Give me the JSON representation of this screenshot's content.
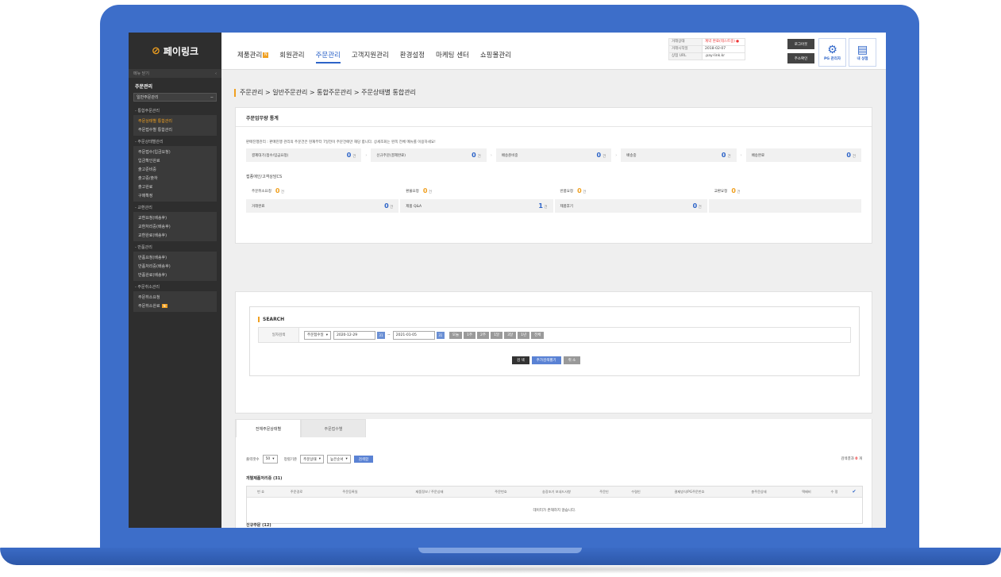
{
  "sidebar": {
    "logo": "페이링크",
    "menu_toggle": "메뉴 닫기",
    "title": "주문관리",
    "select": "일반주문관리",
    "groups": [
      {
        "label": "- 통합주문관리",
        "items": [
          {
            "label": "주문상태별 통합관리",
            "active": true
          },
          {
            "label": "주문접수별 통합관리"
          }
        ]
      },
      {
        "label": "- 주문상태별관리",
        "items": [
          {
            "label": "주문접수(입금요청)"
          },
          {
            "label": "입금확인완료"
          },
          {
            "label": "출고준비중"
          },
          {
            "label": "출고중/출하"
          },
          {
            "label": "출고완료"
          },
          {
            "label": "구매확정"
          }
        ]
      },
      {
        "label": "- 교환관리",
        "items": [
          {
            "label": "교환요청(배송후)"
          },
          {
            "label": "교환처리중(배송후)"
          },
          {
            "label": "교환완료(배송후)"
          }
        ]
      },
      {
        "label": "- 반품관리",
        "items": [
          {
            "label": "반품요청(배송후)"
          },
          {
            "label": "반품처리중(배송후)"
          },
          {
            "label": "반품완료(배송후)"
          }
        ]
      },
      {
        "label": "- 주문취소관리",
        "items": [
          {
            "label": "주문취소요청"
          },
          {
            "label": "주문취소완료",
            "badge": "N"
          }
        ]
      }
    ]
  },
  "header": {
    "tabs": [
      {
        "label": "제품관리",
        "badge": "N"
      },
      {
        "label": "회원관리"
      },
      {
        "label": "주문관리",
        "active": true
      },
      {
        "label": "고객지원관리"
      },
      {
        "label": "환경설정"
      },
      {
        "label": "마케팅 센터"
      },
      {
        "label": "쇼핑몰관리"
      }
    ],
    "info": [
      {
        "label": "거래상태",
        "value": "계약 완료(테스트중)"
      },
      {
        "label": "거래시작일",
        "value": "2018-02-07"
      },
      {
        "label": "상점 URL",
        "value": ".pay-link.kr"
      }
    ],
    "logout": "로그아웃",
    "user_info": "주소확인",
    "pg_admin": "PG 관리자",
    "my_store": "내 상점"
  },
  "breadcrumb": "주문관리 > 일반주문관리 > 통합주문관리 > 주문상태별 통합관리",
  "stats": {
    "title": "주문업무량 통계",
    "note": "판매진행관리 : 판매진행 관리의 주문건은 현재부터 7일전이 주문건에만 해당 합니다. 상세조회는 왼쪽 전체 메뉴를 이용하세요!",
    "unit": "건",
    "flow": [
      {
        "label": "결제대기(접수/입금요청)",
        "count": "0"
      },
      {
        "label": "신규주문(결제완료)",
        "count": "0"
      },
      {
        "label": "배송준비중",
        "count": "0"
      },
      {
        "label": "배송중",
        "count": "0"
      },
      {
        "label": "배송완료",
        "count": "0"
      }
    ],
    "cs_title": "접종애인/고객상담CS",
    "cs": [
      {
        "label": "주문취소요청",
        "count": "0",
        "style": "orange"
      },
      {
        "label": "환불요청",
        "count": "0",
        "style": "orange"
      },
      {
        "label": "반품요청",
        "count": "0",
        "style": "orange"
      },
      {
        "label": "교환요청",
        "count": "0",
        "style": "orange"
      },
      {
        "label": "거래완료",
        "count": "0",
        "style": "blue"
      },
      {
        "label": "제품 Q&A",
        "count": "1",
        "style": "blue"
      },
      {
        "label": "제품후기",
        "count": "0",
        "style": "blue"
      },
      {
        "label": "",
        "count": "",
        "style": "blank"
      }
    ]
  },
  "search": {
    "title": "SEARCH",
    "date_label": "일자검색",
    "date_type": "주문접수일",
    "start_date": "2020-12-29",
    "end_date": "2021-01-05",
    "periods": [
      "오늘",
      "1주",
      "2주",
      "1달",
      "3달",
      "1년",
      "전체"
    ],
    "search_btn": "검 색",
    "detail_btn": "추가검색펼기",
    "cancel_btn": "취 소"
  },
  "list": {
    "tabs": [
      "전체주문상태별",
      "주문접수별"
    ],
    "count_label": "출력갯수",
    "count_value": "50",
    "sort_label": "정렬기준",
    "sort_field": "주문상태",
    "sort_order": "높은순서",
    "apply_btn": "검색함",
    "result_prefix": "검색결과",
    "result_count": "0",
    "result_suffix": "개",
    "section1": "개별제품처리중 (31)",
    "columns": [
      "번 호",
      "주문경로",
      "주문등록일",
      "제품정보 / 주문상태",
      "주문번호",
      "송장조기 보내드사항",
      "주문인",
      "수령인",
      "결제방식/PG주문번호",
      "총주문상태",
      "택배비",
      "수 정"
    ],
    "empty": "데이터가 존재하지 않습니다.",
    "section2": "신규주문 (12)"
  }
}
